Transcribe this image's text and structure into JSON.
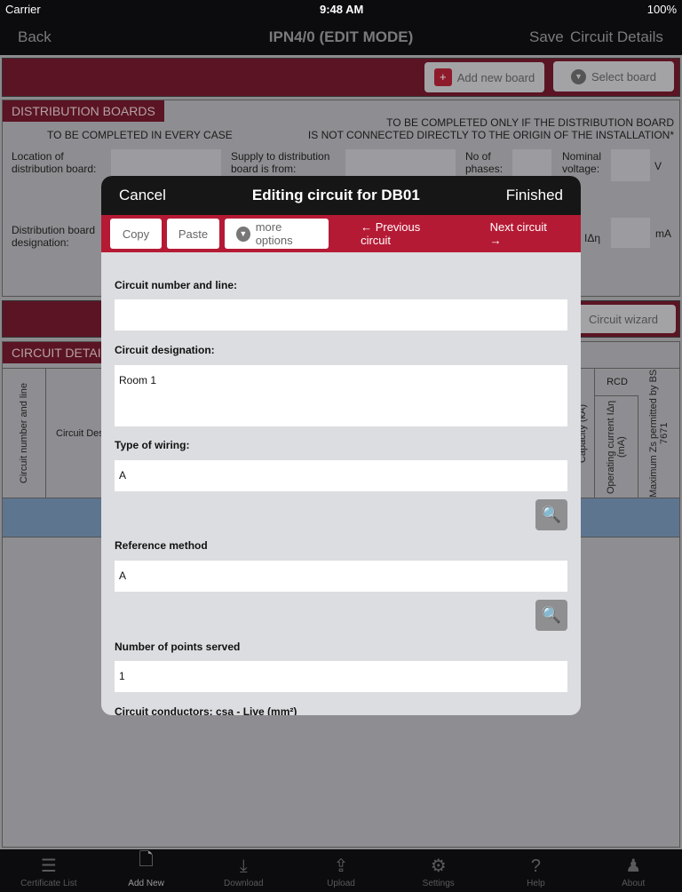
{
  "status": {
    "carrier": "Carrier",
    "time": "9:48 AM",
    "battery": "100%"
  },
  "nav": {
    "back": "Back",
    "title": "IPN4/0 (EDIT MODE)",
    "save": "Save",
    "details": "Circuit Details"
  },
  "toolbar": {
    "add_board": "Add new board",
    "select_board": "Select board",
    "circuit_wizard": "Circuit wizard"
  },
  "boards": {
    "header": "DISTRIBUTION BOARDS",
    "every_case": "TO BE COMPLETED IN EVERY CASE",
    "only_if_1": "TO BE COMPLETED ONLY IF THE DISTRIBUTION BOARD",
    "only_if_2": "IS NOT CONNECTED DIRECTLY TO THE ORIGIN OF THE INSTALLATION*",
    "location": "Location of distribution board:",
    "supply": "Supply to distribution board is from:",
    "phases": "No of phases:",
    "voltage": "Nominal voltage:",
    "voltage_unit": "V",
    "designation": "Distribution board designation:",
    "idn": "IΔη",
    "idn_unit": "mA"
  },
  "circuits": {
    "header": "CIRCUIT DETAILS",
    "col_number": "Circuit number and line",
    "col_desc": "Circuit Description",
    "col_capacity": "Capacity (kA)",
    "rcd": "RCD",
    "col_operating": "Operating current IΔη (mA)",
    "col_maxzs": "Maximum Zs permitted by BS 7671"
  },
  "modal": {
    "cancel": "Cancel",
    "title": "Editing circuit for DB01",
    "finished": "Finished",
    "copy": "Copy",
    "paste": "Paste",
    "more": "more options",
    "prev": "← Previous circuit",
    "next": "Next circuit →",
    "fields": [
      {
        "label": "Circuit number and line:",
        "value": ""
      },
      {
        "label": "Circuit designation:",
        "value": "Room 1"
      },
      {
        "label": "Type of wiring:",
        "value": "A"
      },
      {
        "label": "Reference method",
        "value": "A"
      },
      {
        "label": "Number of points served",
        "value": "1"
      },
      {
        "label": "Circuit conductors: csa - Live (mm²)",
        "value": ""
      }
    ]
  },
  "tabs": [
    {
      "label": "Certificate List",
      "icon": "list-icon"
    },
    {
      "label": "Add New",
      "icon": "add-document-icon"
    },
    {
      "label": "Download",
      "icon": "download-icon"
    },
    {
      "label": "Upload",
      "icon": "upload-icon"
    },
    {
      "label": "Settings",
      "icon": "gear-icon"
    },
    {
      "label": "Help",
      "icon": "help-icon"
    },
    {
      "label": "About",
      "icon": "person-icon"
    }
  ],
  "colors": {
    "accent": "#b51a35",
    "nav": "#0c0c0e"
  }
}
